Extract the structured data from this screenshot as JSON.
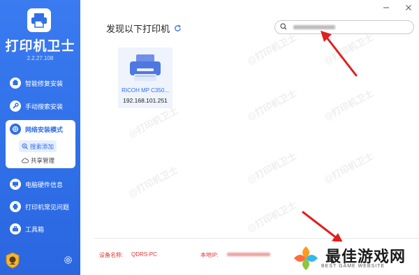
{
  "app": {
    "name": "打印机卫士",
    "version": "2.2.27.108"
  },
  "sidebar": {
    "items": [
      {
        "label": "智能修复安装",
        "icon": "repair-icon"
      },
      {
        "label": "手动搜索安装",
        "icon": "wrench-icon"
      }
    ],
    "active_group": {
      "label": "网络安装模式",
      "icon": "network-icon",
      "sub_items": [
        {
          "label": "搜索添加",
          "icon": "search-add-icon",
          "selected": true
        },
        {
          "label": "共享管理",
          "icon": "cloud-icon",
          "selected": false
        }
      ]
    },
    "lower_items": [
      {
        "label": "电脑硬件信息",
        "icon": "computer-icon"
      },
      {
        "label": "打印机常见问题",
        "icon": "printer-question-icon"
      },
      {
        "label": "工具箱",
        "icon": "toolbox-icon"
      }
    ]
  },
  "main": {
    "title": "发现以下打印机",
    "search": {
      "value": "",
      "placeholder": ""
    },
    "printers": [
      {
        "name": "RICOH MP C350...",
        "ip": "192.168.101.251"
      }
    ],
    "footer": {
      "device_label": "设备名称:",
      "device_value": "QDRS-PC",
      "ip_label": "本地IP:"
    }
  },
  "watermark": "@打印机卫士",
  "brand": {
    "title": "最佳游戏网",
    "subtitle": "BEST GAME WEBSITE"
  },
  "colors": {
    "sidebar": "#2f6fe8",
    "accent": "#2f6fe8",
    "footer_text": "#e03232",
    "arrow": "#e02020"
  }
}
